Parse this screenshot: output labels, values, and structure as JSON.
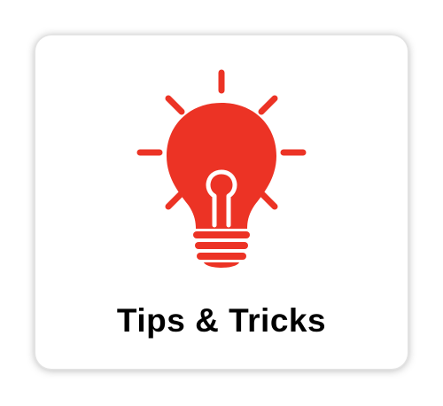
{
  "card": {
    "title": "Tips & Tricks",
    "icon": "lightbulb-icon",
    "accent_color": "#ec3325"
  }
}
